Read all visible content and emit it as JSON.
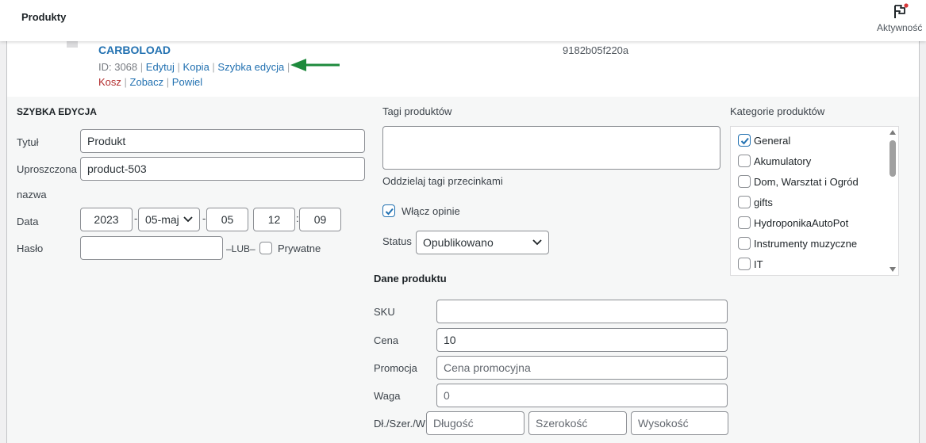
{
  "header": {
    "title": "Produkty",
    "activity_label": "Aktywność"
  },
  "product_row": {
    "name": "CARBOLOAD",
    "id_text": "ID: 3068",
    "actions_line1": [
      "Edytuj",
      "Kopia",
      "Szybka edycja"
    ],
    "actions_line2": {
      "trash": "Kosz",
      "view": "Zobacz",
      "duplicate": "Powiel"
    },
    "sku": "9182b05f220a"
  },
  "quick_edit": {
    "legend": "Szybka edycja",
    "title_label": "Tytuł",
    "title_value": "Produkt",
    "slug_label_1": "Uproszczona",
    "slug_label_2": "nazwa",
    "slug_value": "product-503",
    "date_label": "Data",
    "date": {
      "year": "2023",
      "month": "05-maj",
      "day": "05",
      "hour": "12",
      "minute": "09",
      "dash": "-",
      "colon": ":"
    },
    "password_label": "Hasło",
    "password_value": "",
    "or_text": "–LUB–",
    "private_label": "Prywatne",
    "private_checked": false
  },
  "tags": {
    "label": "Tagi produktów",
    "value": "",
    "hint": "Oddzielaj tagi przecinkami"
  },
  "comments": {
    "label": "Włącz opinie",
    "checked": true
  },
  "status": {
    "label": "Status",
    "value": "Opublikowano"
  },
  "product_data": {
    "heading": "Dane produktu",
    "sku_label": "SKU",
    "sku_value": "",
    "price_label": "Cena",
    "price_value": "10",
    "sale_label": "Promocja",
    "sale_placeholder": "Cena promocyjna",
    "weight_label": "Waga",
    "weight_placeholder": "0",
    "dims_label": "Dł./Szer./W",
    "length_placeholder": "Długość",
    "width_placeholder": "Szerokość",
    "height_placeholder": "Wysokość"
  },
  "categories": {
    "label": "Kategorie produktów",
    "items": [
      {
        "label": "General",
        "checked": true
      },
      {
        "label": "Akumulatory",
        "checked": false
      },
      {
        "label": "Dom, Warsztat i Ogród",
        "checked": false
      },
      {
        "label": "gifts",
        "checked": false
      },
      {
        "label": "HydroponikaAutoPot",
        "checked": false
      },
      {
        "label": "Instrumenty muzyczne",
        "checked": false
      },
      {
        "label": "IT",
        "checked": false
      }
    ]
  },
  "colors": {
    "link": "#2271b1",
    "trash": "#b32d2e",
    "arrow": "#1e8a3c",
    "notification": "#d63638"
  }
}
